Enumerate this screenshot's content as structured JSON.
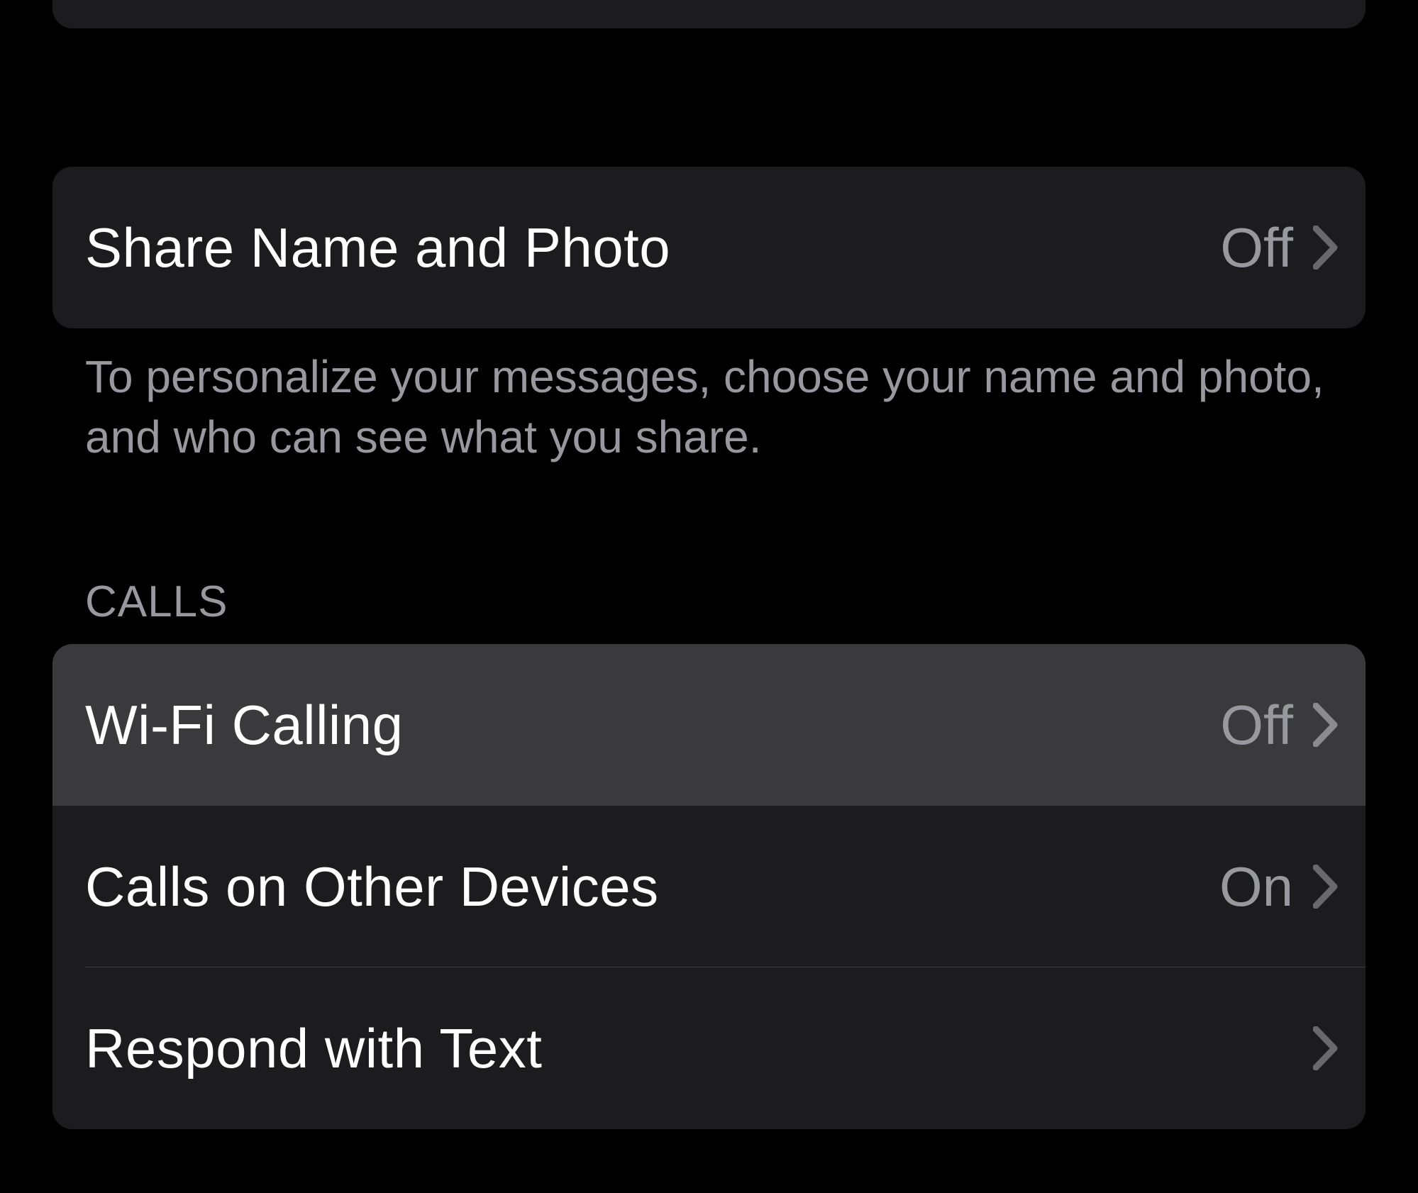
{
  "top_stub": {},
  "share_section": {
    "items": [
      {
        "label": "Share Name and Photo",
        "value": "Off"
      }
    ],
    "footer": "To personalize your messages, choose your name and photo, and who can see what you share."
  },
  "calls_section": {
    "header": "CALLS",
    "items": [
      {
        "label": "Wi-Fi Calling",
        "value": "Off",
        "highlighted": true
      },
      {
        "label": "Calls on Other Devices",
        "value": "On"
      },
      {
        "label": "Respond with Text",
        "value": ""
      }
    ]
  }
}
